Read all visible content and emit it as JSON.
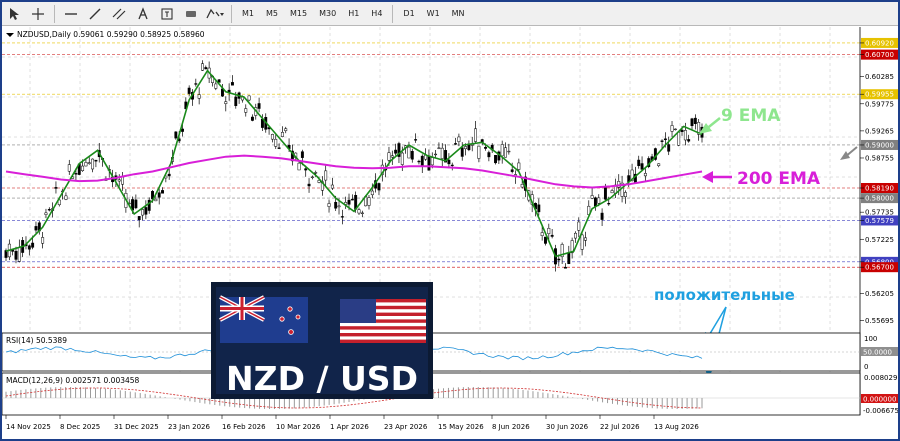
{
  "toolbar": {
    "tools": [
      "cursor-icon",
      "crosshair-icon",
      "hline-icon",
      "trendline-icon",
      "channel-icon",
      "text-tool-icon",
      "label-tool-icon",
      "rectangle-icon",
      "arrows-icon"
    ],
    "timeframes": [
      "M1",
      "M5",
      "M15",
      "M30",
      "H1",
      "H4",
      "D1",
      "W1",
      "MN"
    ]
  },
  "main": {
    "symbol_line": "NZDUSD,Daily  0.59061 0.59290 0.58925 0.58960",
    "price_labels": [
      "0.60920",
      "0.60700",
      "0.60285",
      "0.59955",
      "0.59775",
      "0.59265",
      "0.59000",
      "0.58755",
      "0.58190",
      "0.58000",
      "0.57735",
      "0.57579",
      "0.57225",
      "0.56800",
      "0.56700",
      "0.56205",
      "0.55695"
    ],
    "price_label_colors": [
      "#e6c200",
      "#c80000",
      "",
      "#e6c200",
      "",
      "",
      "#808080",
      "",
      "#c80000",
      "#808080",
      "",
      "#4040c0",
      "",
      "#4040c0",
      "#c80000",
      "",
      ""
    ],
    "ema9_label": "9 EMA",
    "ema200_label": "200 EMA",
    "positive_label": "положительные",
    "logo_text": "NZD / USD"
  },
  "rsi": {
    "title": "RSI(14) 50.5389",
    "scale": [
      "100",
      "50.0000",
      "0"
    ]
  },
  "macd": {
    "title": "MACD(12,26,9) 0.002571 0.003458",
    "scale": [
      "0.008029",
      "0.000000",
      "-0.006675"
    ]
  },
  "dates": [
    "14 Nov 2025",
    "8 Dec 2025",
    "31 Dec 2025",
    "23 Jan 2026",
    "16 Feb 2026",
    "10 Mar 2026",
    "1 Apr 2026",
    "23 Apr 2026",
    "15 May 2026",
    "8 Jun 2026",
    "30 Jun 2026",
    "22 Jul 2026",
    "13 Aug 2026"
  ],
  "colors": {
    "ema9_label": "#8ee68e",
    "ema200_label": "#d81fd8",
    "positive_label": "#1fa0e0",
    "candle": "#000000",
    "grid": "#c0c0c0"
  },
  "chart_data": {
    "type": "line",
    "symbol": "NZDUSD",
    "timeframe": "Daily",
    "ohlc_last": {
      "open": 0.59061,
      "high": 0.5929,
      "low": 0.58925,
      "close": 0.5896
    },
    "price_range": [
      0.5548,
      0.6122
    ],
    "series": [
      {
        "name": "9 EMA",
        "values": [
          0.57,
          0.571,
          0.5745,
          0.5805,
          0.5865,
          0.589,
          0.583,
          0.577,
          0.5795,
          0.5865,
          0.5985,
          0.604,
          0.6,
          0.599,
          0.595,
          0.591,
          0.587,
          0.584,
          0.58,
          0.5775,
          0.582,
          0.587,
          0.59,
          0.588,
          0.587,
          0.59,
          0.5905,
          0.588,
          0.585,
          0.577,
          0.569,
          0.57,
          0.578,
          0.58,
          0.583,
          0.586,
          0.59,
          0.5935,
          0.592
        ]
      },
      {
        "name": "200 EMA",
        "values": [
          0.585,
          0.5845,
          0.584,
          0.5835,
          0.5832,
          0.5833,
          0.5838,
          0.5845,
          0.585,
          0.5858,
          0.5866,
          0.5872,
          0.5878,
          0.588,
          0.5878,
          0.5875,
          0.587,
          0.5865,
          0.586,
          0.5857,
          0.5856,
          0.5857,
          0.586,
          0.586,
          0.5858,
          0.5856,
          0.5852,
          0.5846,
          0.584,
          0.5833,
          0.5826,
          0.5822,
          0.582,
          0.5822,
          0.5826,
          0.5832,
          0.5838,
          0.5844,
          0.585
        ]
      }
    ],
    "indicators": {
      "rsi_14": 50.5389,
      "macd": 0.002571,
      "macd_signal": 0.003458
    },
    "x_tick_labels": [
      "14 Nov 2025",
      "8 Dec 2025",
      "31 Dec 2025",
      "23 Jan 2026",
      "16 Feb 2026",
      "10 Mar 2026",
      "1 Apr 2026",
      "23 Apr 2026",
      "15 May 2026",
      "8 Jun 2026",
      "30 Jun 2026",
      "22 Jul 2026",
      "13 Aug 2026"
    ],
    "grid": true
  }
}
